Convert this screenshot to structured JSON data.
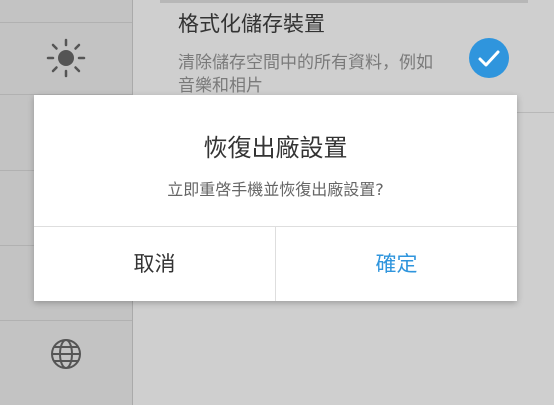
{
  "sidebar": {
    "icons": [
      "brightness-icon",
      "globe-icon"
    ]
  },
  "setting": {
    "title": "格式化儲存裝置",
    "description": "清除儲存空間中的所有資料，例如音樂和相片",
    "checked": true
  },
  "dialog": {
    "title": "恢復出廠設置",
    "message": "立即重啓手機並恢復出廠設置?",
    "cancel_label": "取消",
    "confirm_label": "確定"
  },
  "colors": {
    "accent": "#2f95dd",
    "dim_background": "#c9c9c9"
  }
}
